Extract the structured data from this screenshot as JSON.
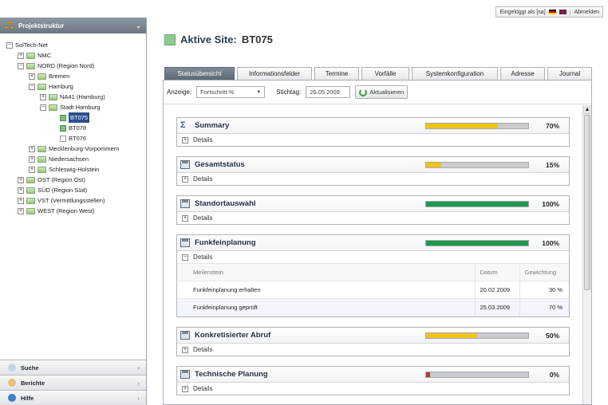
{
  "topbar": {
    "logged_in": "Eingeloggt als [sa]",
    "separator": "|",
    "logout": "Abmelden"
  },
  "sidebar": {
    "title": "Projektstruktur",
    "tree": [
      {
        "label": "SolTech-Net",
        "level": 0,
        "toggle": "minus",
        "icon": "none"
      },
      {
        "label": "NMC",
        "level": 1,
        "toggle": "plus",
        "icon": "folder"
      },
      {
        "label": "NORD (Region Nord)",
        "level": 1,
        "toggle": "minus",
        "icon": "folder"
      },
      {
        "label": "Bremen",
        "level": 2,
        "toggle": "plus",
        "icon": "folder"
      },
      {
        "label": "Hamburg",
        "level": 2,
        "toggle": "minus",
        "icon": "folder"
      },
      {
        "label": "NA41 (Hamburg)",
        "level": 3,
        "toggle": "plus",
        "icon": "folder"
      },
      {
        "label": "Stadt Hamburg",
        "level": 3,
        "toggle": "minus",
        "icon": "folder"
      },
      {
        "label": "BT075",
        "level": 4,
        "toggle": "none",
        "icon": "site",
        "selected": true
      },
      {
        "label": "BT078",
        "level": 4,
        "toggle": "none",
        "icon": "site"
      },
      {
        "label": "BT076",
        "level": 4,
        "toggle": "none",
        "icon": "site-empty"
      },
      {
        "label": "Mecklenburg-Vorpommern",
        "level": 2,
        "toggle": "plus",
        "icon": "folder"
      },
      {
        "label": "Niedersachsen",
        "level": 2,
        "toggle": "plus",
        "icon": "folder"
      },
      {
        "label": "Schleswig-Holstein",
        "level": 2,
        "toggle": "plus",
        "icon": "folder"
      },
      {
        "label": "OST (Region Ost)",
        "level": 1,
        "toggle": "plus",
        "icon": "folder"
      },
      {
        "label": "SÜD (Region Süd)",
        "level": 1,
        "toggle": "plus",
        "icon": "folder"
      },
      {
        "label": "VST (Vermittlungsstellen)",
        "level": 1,
        "toggle": "plus",
        "icon": "folder"
      },
      {
        "label": "WEST (Region West)",
        "level": 1,
        "toggle": "plus",
        "icon": "folder"
      }
    ],
    "footer": [
      {
        "label": "Suche",
        "icon": "search-icon"
      },
      {
        "label": "Berichte",
        "icon": "reports-icon"
      },
      {
        "label": "Hilfe",
        "icon": "help-icon"
      }
    ]
  },
  "header": {
    "title_label": "Aktive Site:",
    "title_value": "BT075"
  },
  "tabs": [
    "Statusübersicht",
    "Informationsfelder",
    "Termine",
    "Vorfälle",
    "Systemkonfiguration",
    "Adresse",
    "Journal"
  ],
  "active_tab": 0,
  "filter": {
    "view_label": "Anzeige:",
    "view_value": "Fortschritt %",
    "date_label": "Stichtag:",
    "date_value": "26.05.2009",
    "refresh_label": "Aktualisieren"
  },
  "colors": {
    "yellow": "#f0c419",
    "green": "#1f9a4c",
    "red": "#c0392b"
  },
  "details_label": "Details",
  "panels": [
    {
      "title": "Summary",
      "icon": "sigma",
      "progress": 0.7,
      "pct": "70%",
      "color": "yellow",
      "expanded": false
    },
    {
      "title": "Gesamtstatus",
      "icon": "calendar",
      "progress": 0.15,
      "pct": "15%",
      "color": "yellow",
      "expanded": false
    },
    {
      "title": "Standortauswahl",
      "icon": "calendar",
      "progress": 1.0,
      "pct": "100%",
      "color": "green",
      "expanded": false
    },
    {
      "title": "Funkfeinplanung",
      "icon": "calendar",
      "progress": 1.0,
      "pct": "100%",
      "color": "green",
      "expanded": true,
      "table": {
        "headers": [
          "Meilenstein",
          "Datum",
          "Gewichtung"
        ],
        "rows": [
          [
            "Funkfeinplanung erhalten",
            "20.02.2009",
            "30 %"
          ],
          [
            "Funkfeinplanung geprüft",
            "25.03.2009",
            "70 %"
          ]
        ]
      }
    },
    {
      "title": "Konkretisierter Abruf",
      "icon": "calendar",
      "progress": 0.5,
      "pct": "50%",
      "color": "yellow",
      "expanded": false
    },
    {
      "title": "Technische Planung",
      "icon": "calendar",
      "progress": 0.04,
      "pct": "0%",
      "color": "red",
      "expanded": false
    }
  ]
}
